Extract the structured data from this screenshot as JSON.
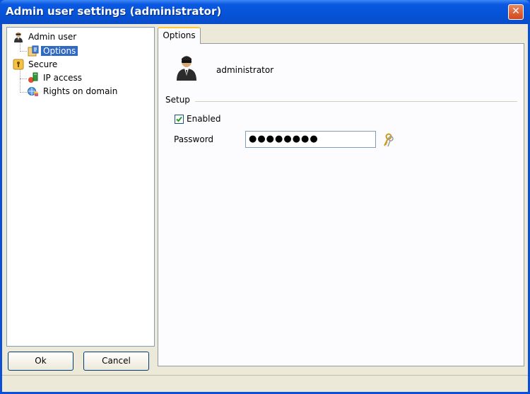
{
  "window": {
    "title": "Admin user settings (administrator)",
    "close_symbol": "✕"
  },
  "tree": {
    "items": [
      {
        "label": "Admin user",
        "icon": "admin-user-icon"
      },
      {
        "label": "Options",
        "icon": "options-icon",
        "selected": true
      },
      {
        "label": "Secure",
        "icon": "secure-icon"
      },
      {
        "label": "IP access",
        "icon": "ip-access-icon"
      },
      {
        "label": "Rights on domain",
        "icon": "rights-domain-icon"
      }
    ]
  },
  "buttons": {
    "ok": "Ok",
    "cancel": "Cancel"
  },
  "tab": {
    "label": "Options"
  },
  "options": {
    "username": "administrator",
    "setup_label": "Setup",
    "enabled_label": "Enabled",
    "enabled_checked": true,
    "password_label": "Password",
    "password_value": "●●●●●●●●"
  },
  "colors": {
    "titlebar": "#0553d8",
    "selection": "#316ac5",
    "close": "#d2471c",
    "tab_accent": "#ffc83c"
  }
}
